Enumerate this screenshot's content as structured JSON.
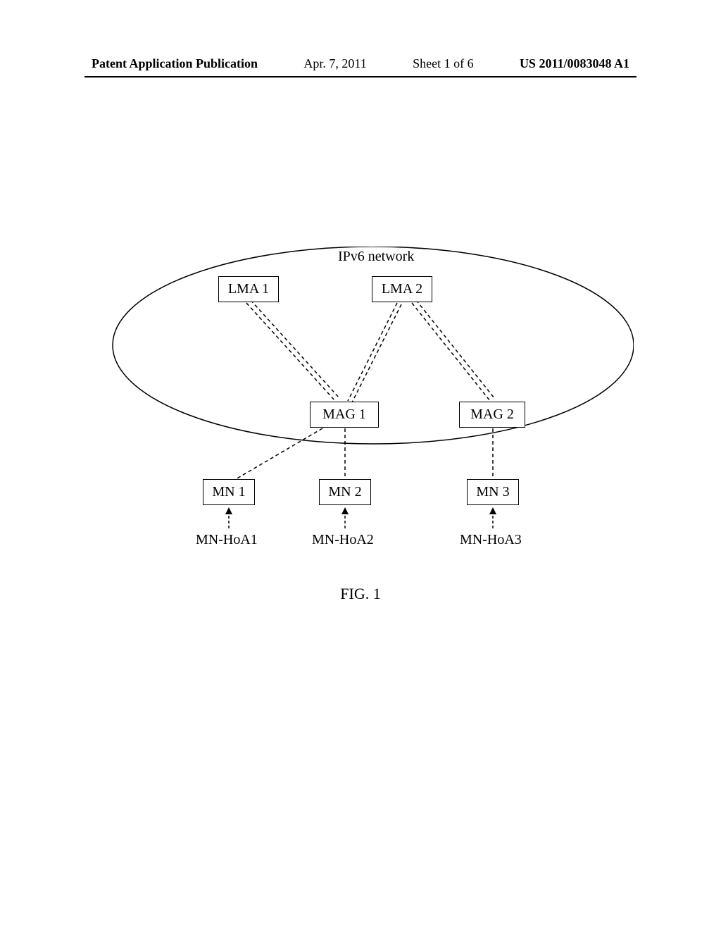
{
  "header": {
    "publication_type": "Patent Application Publication",
    "date": "Apr. 7, 2011",
    "sheet": "Sheet 1 of 6",
    "app_number": "US 2011/0083048 A1"
  },
  "diagram": {
    "network_label": "IPv6 network",
    "lma1": "LMA 1",
    "lma2": "LMA 2",
    "mag1": "MAG 1",
    "mag2": "MAG 2",
    "mn1": "MN 1",
    "mn2": "MN 2",
    "mn3": "MN 3",
    "hoa1": "MN-HoA1",
    "hoa2": "MN-HoA2",
    "hoa3": "MN-HoA3",
    "figure_label": "FIG. 1"
  }
}
